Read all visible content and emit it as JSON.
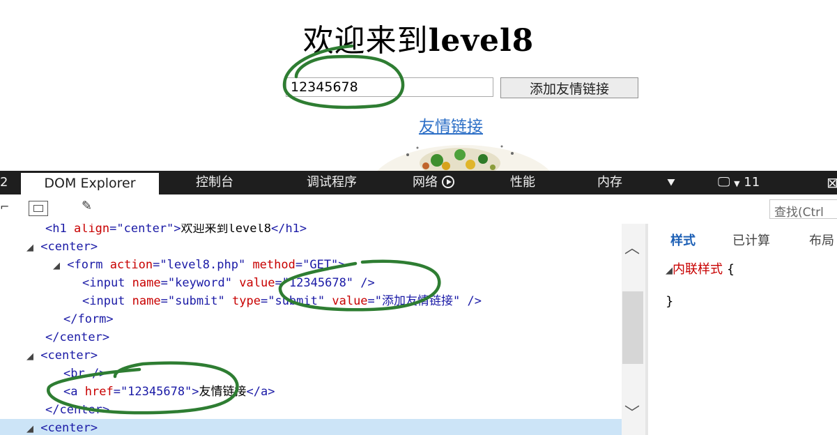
{
  "page": {
    "title_cn": "欢迎来到",
    "title_en": "level8",
    "input_value": "12345678",
    "submit_label": "添加友情链接",
    "link_label": "友情链接"
  },
  "devtools": {
    "tabs": {
      "dom_explorer": "DOM Explorer",
      "console": "控制台",
      "debugger": "调试程序",
      "network": "网络",
      "performance": "性能",
      "memory": "内存",
      "emulation_value": "11"
    },
    "find_placeholder": "查找(Ctrl",
    "dom_lines": {
      "l1_tag": "<h1",
      "l1_attr": "align",
      "l1_val": "\"center\"",
      "l1_text": "欢迎来到level8",
      "l2": "<center>",
      "l3_tag": "<form",
      "l3_attr1": "action",
      "l3_val1": "\"level8.php\"",
      "l3_attr2": "method",
      "l3_val2": "\"GET\"",
      "l4_tag": "<input",
      "l4_attr1": "name",
      "l4_val1": "\"keyword\"",
      "l4_attr2": "value",
      "l4_val2": "\"12345678\"",
      "l5_tag": "<input",
      "l5_attr1": "name",
      "l5_val1": "\"submit\"",
      "l5_attr2": "type",
      "l5_val2": "\"submit\"",
      "l5_attr3": "value",
      "l5_val3": "\"添加友情链接\"",
      "l6": "</form>",
      "l7": "</center>",
      "l8": "<center>",
      "l9": "<br />",
      "l10_tag": "<a",
      "l10_attr": "href",
      "l10_val": "\"12345678\"",
      "l10_text": "友情链接",
      "l10_close": "</a>",
      "l11": "</center>",
      "l12": "<center>"
    },
    "styles": {
      "tab_styles": "样式",
      "tab_computed": "已计算",
      "tab_layout": "布局",
      "inline_label": "内联样式",
      "open_brace": "{",
      "close_brace": "}"
    }
  },
  "colors": {
    "tag": "#1a1aa6",
    "attr_name": "#c80000",
    "annotation": "#2e7d32"
  }
}
